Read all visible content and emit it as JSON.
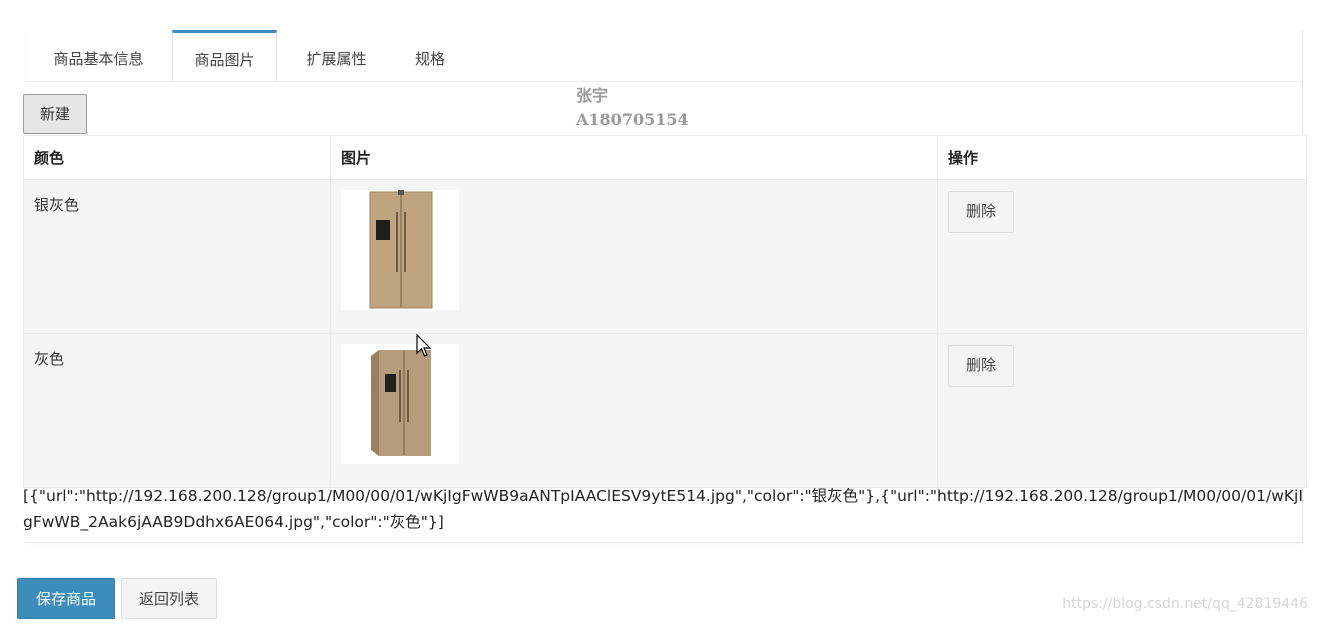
{
  "tabs": [
    {
      "label": "商品基本信息"
    },
    {
      "label": "商品图片"
    },
    {
      "label": "扩展属性"
    },
    {
      "label": "规格"
    }
  ],
  "new_button": "新建",
  "watermark": {
    "line1": "张宇",
    "line2": "A180705154"
  },
  "table": {
    "headers": [
      "颜色",
      "图片",
      "操作"
    ],
    "rows": [
      {
        "color": "银灰色",
        "image_icon": "refrigerator-image",
        "action": "删除"
      },
      {
        "color": "灰色",
        "image_icon": "refrigerator-image",
        "action": "删除"
      }
    ]
  },
  "json_output": "[{\"url\":\"http://192.168.200.128/group1/M00/00/01/wKjIgFwWB9aANTpIAAClESV9ytE514.jpg\",\"color\":\"银灰色\"},{\"url\":\"http://192.168.200.128/group1/M00/00/01/wKjIgFwWB_2Aak6jAAB9Ddhx6AE064.jpg\",\"color\":\"灰色\"}]",
  "footer": {
    "save_label": "保存商品",
    "back_label": "返回列表"
  },
  "csdn_watermark": "https://blog.csdn.net/qq_42819446",
  "colors": {
    "accent": "#3c8dbc",
    "row_bg": "#f5f5f5",
    "fridge": "#b79c7c"
  }
}
